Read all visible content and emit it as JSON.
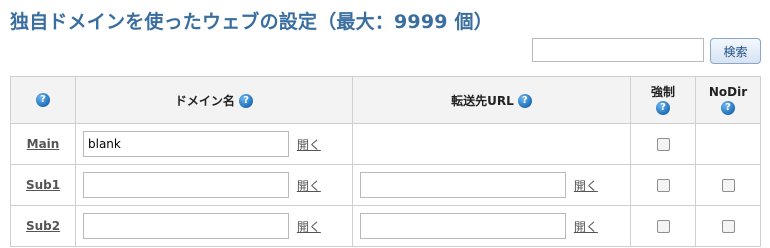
{
  "page": {
    "title": "独自ドメインを使ったウェブの設定（最大：9999 個）"
  },
  "search": {
    "value": "",
    "button_label": "検索"
  },
  "table": {
    "headers": {
      "help_col": "?",
      "domain": "ドメイン名",
      "redirect": "転送先URL",
      "force": "強制",
      "nodir": "NoDir"
    },
    "help_glyph": "?",
    "open_label": "開く",
    "rows": [
      {
        "label": "Main",
        "domain_value": "blank",
        "redirect_value": "",
        "force": false
      },
      {
        "label": "Sub1",
        "domain_value": "",
        "redirect_value": "",
        "force": false,
        "nodir": false
      },
      {
        "label": "Sub2",
        "domain_value": "",
        "redirect_value": "",
        "force": false,
        "nodir": false
      }
    ]
  },
  "colors": {
    "title": "#3a6e9f",
    "help_icon": "#1f6fb8",
    "header_bg": "#f3f3f3"
  }
}
